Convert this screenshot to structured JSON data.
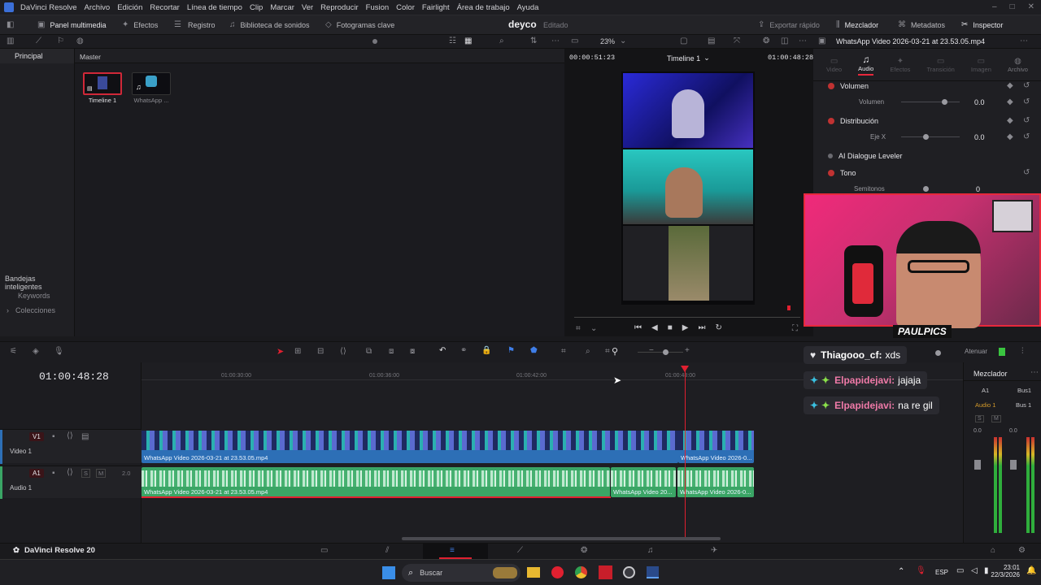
{
  "app": {
    "title": "DaVinci Resolve"
  },
  "menu": [
    "DaVinci Resolve",
    "Archivo",
    "Edición",
    "Recortar",
    "Línea de tiempo",
    "Clip",
    "Marcar",
    "Ver",
    "Reproducir",
    "Fusion",
    "Color",
    "Fairlight",
    "Área de trabajo",
    "Ayuda"
  ],
  "toolbar": {
    "media_pool": "Panel multimedia",
    "effects": "Efectos",
    "log": "Registro",
    "sound_library": "Biblioteca de sonidos",
    "keyframes": "Fotogramas clave",
    "project_name": "deyco",
    "project_status": "Editado",
    "quick_export": "Exportar rápido",
    "mixer": "Mezclador",
    "metadata": "Metadatos",
    "inspector": "Inspector"
  },
  "viewer": {
    "zoom": "23%",
    "timecode_left": "00:00:51:23",
    "timeline_name": "Timeline 1",
    "timecode_right": "01:00:48:28"
  },
  "inspector_header": {
    "clip_name": "WhatsApp Video 2026-03-21 at 23.53.05.mp4"
  },
  "inspector_tabs": [
    "Video",
    "Audio",
    "Efectos",
    "Transición",
    "Imagen",
    "Archivo"
  ],
  "inspector": {
    "volume": {
      "title": "Volumen",
      "label": "Volumen",
      "value": "0.0"
    },
    "pan": {
      "title": "Distribución",
      "label": "Eje X",
      "value": "0.0"
    },
    "ai_leveler": "AI Dialogue Leveler",
    "pitch": {
      "title": "Tono",
      "label": "Semitonos",
      "value": "0"
    }
  },
  "left_panel": {
    "principal": "Principal",
    "smart_bins": "Bandejas inteligentes",
    "keywords": "Keywords",
    "collections": "Colecciones"
  },
  "media_pool": {
    "bin": "Master",
    "items": [
      {
        "label": "Timeline 1"
      },
      {
        "label": "WhatsApp ..."
      }
    ]
  },
  "timeline": {
    "timecode": "01:00:48:28",
    "ticks": [
      "01:00:30:00",
      "01:00:36:00",
      "01:00:42:00",
      "01:00:48:00"
    ],
    "v1": {
      "id": "V1",
      "name": "Video 1"
    },
    "a1": {
      "id": "A1",
      "name": "Audio 1",
      "ch": "2.0",
      "s": "S",
      "m": "M"
    },
    "clips": {
      "video_main": "WhatsApp Video 2026-03-21 at 23.53.05.mp4",
      "video_end": "WhatsApp Video 2026-0...",
      "audio_main": "WhatsApp Video 2026-03-21 at 23.53.05.mp4",
      "audio_mid": "WhatsApp Video 20...",
      "audio_end": "WhatsApp Video 2026-0..."
    },
    "dim_label": "Atenuar"
  },
  "mixer": {
    "title": "Mezclador",
    "ch1": "A1",
    "ch2": "Bus1",
    "ch1_name": "Audio 1",
    "ch2_name": "Bus 1",
    "s": "S",
    "m": "M",
    "val1": "0.0",
    "val2": "0.0"
  },
  "stream": {
    "badge": "PAULPICS",
    "chat": [
      {
        "user": "Thiagooo_cf:",
        "msg": "xds"
      },
      {
        "user": "Elpapidejavi:",
        "msg": "jajaja"
      },
      {
        "user": "Elpapidejavi:",
        "msg": "na re gil"
      }
    ]
  },
  "pagebar": {
    "brand": "DaVinci Resolve 20"
  },
  "taskbar": {
    "search": "Buscar",
    "lang": "ESP",
    "time": "23:01",
    "date": "22/3/2026"
  },
  "colors": {
    "accent_red": "#e8283c",
    "clip_blue": "#2d6fb6",
    "clip_green": "#3aa565",
    "playhead": "#e02030"
  }
}
